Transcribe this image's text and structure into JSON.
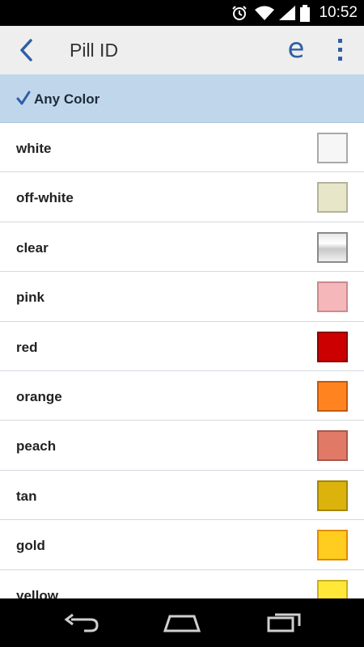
{
  "status_bar": {
    "time": "10:52",
    "icons": [
      "alarm-icon",
      "wifi-icon",
      "signal-icon",
      "battery-icon"
    ]
  },
  "app_bar": {
    "title": "Pill ID",
    "back_icon": "chevron-left-icon",
    "action_icon": "e-logo-icon",
    "menu_icon": "more-vertical-icon"
  },
  "filter": {
    "label": "Any Color",
    "selected": true
  },
  "colors": [
    {
      "name": "white",
      "swatch": "#f6f6f6",
      "border": "#a8a8a8"
    },
    {
      "name": "off-white",
      "swatch": "#e8e6c8",
      "border": "#b4b29a"
    },
    {
      "name": "clear",
      "swatch": "#d9d9d9",
      "border": "#8a8a8a"
    },
    {
      "name": "pink",
      "swatch": "#f6b7bb",
      "border": "#c98a8e"
    },
    {
      "name": "red",
      "swatch": "#cc0000",
      "border": "#8a0000"
    },
    {
      "name": "orange",
      "swatch": "#ff8420",
      "border": "#c45a10"
    },
    {
      "name": "peach",
      "swatch": "#e07a66",
      "border": "#a9584a"
    },
    {
      "name": "tan",
      "swatch": "#dcb20c",
      "border": "#a58608"
    },
    {
      "name": "gold",
      "swatch": "#ffcd1f",
      "border": "#e08a00"
    },
    {
      "name": "yellow",
      "swatch": "#ffe837",
      "border": "#c8b020"
    }
  ],
  "nav_bar": {
    "icons": [
      "back-nav-icon",
      "home-nav-icon",
      "recents-nav-icon"
    ]
  },
  "theme": {
    "accent": "#2f5fa6",
    "selected_row_bg": "#c0d7eb",
    "app_bar_bg": "#eeeeee"
  }
}
